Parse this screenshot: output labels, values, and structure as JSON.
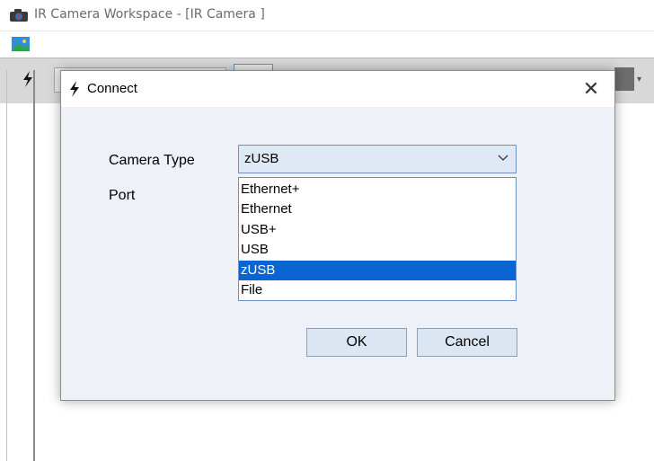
{
  "window": {
    "title": "IR Camera Workspace - [IR Camera ]"
  },
  "icons": {
    "app": "camera-icon",
    "menubar": "image-icon",
    "toolbar": "lightning-icon",
    "dialog": "lightning-icon",
    "close": "close-icon",
    "combo_arrow": "chevron-down-icon"
  },
  "dialog": {
    "title": "Connect",
    "close_glyph": "✕",
    "camera_type_label": "Camera Type",
    "port_label": "Port",
    "camera_type_value": "zUSB",
    "options": [
      "Ethernet+",
      "Ethernet",
      "USB+",
      "USB",
      "zUSB",
      "File"
    ],
    "selected_index": 4,
    "ok_label": "OK",
    "cancel_label": "Cancel"
  },
  "colors": {
    "selection": "#0a64d2",
    "dialog_bg": "#eef2f8",
    "button_bg": "#dce6f2"
  }
}
